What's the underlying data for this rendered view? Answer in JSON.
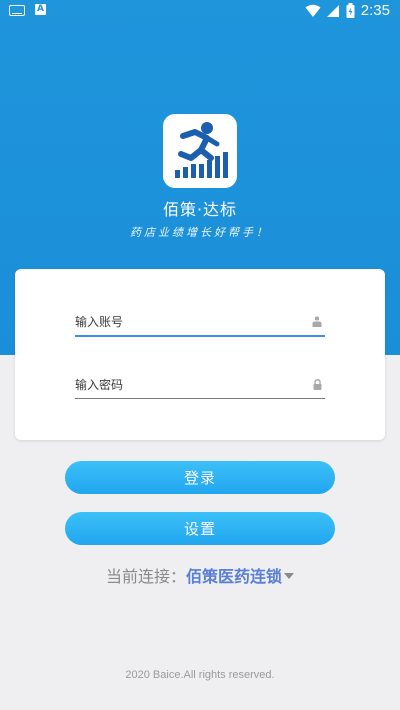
{
  "status_bar": {
    "time": "2:35"
  },
  "app": {
    "name": "佰策·达标",
    "slogan": "药店业绩增长好帮手！"
  },
  "login": {
    "account_placeholder": "输入账号",
    "password_placeholder": "输入密码",
    "login_label": "登录",
    "settings_label": "设置"
  },
  "connection": {
    "label": "当前连接：",
    "value": "佰策医药连锁"
  },
  "footer": {
    "copyright": "2020 Baice.All rights reserved."
  },
  "colors": {
    "brand_blue": "#1f95dc",
    "button_blue": "#2aaef2",
    "connection_blue": "#5a7fd4"
  }
}
